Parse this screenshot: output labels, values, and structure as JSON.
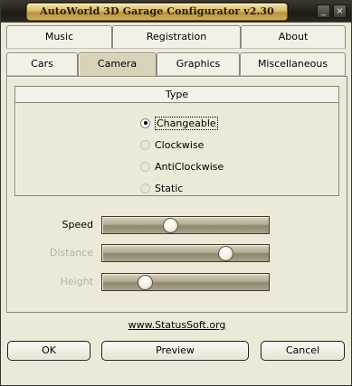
{
  "window": {
    "title": "AutoWorld 3D Garage Configurator v2.30",
    "minimize_glyph": "_",
    "close_glyph": "×"
  },
  "tabs_row1": [
    {
      "label": "Music"
    },
    {
      "label": "Registration"
    },
    {
      "label": "About"
    }
  ],
  "tabs_row2": [
    {
      "label": "Cars",
      "active": false
    },
    {
      "label": "Camera",
      "active": true
    },
    {
      "label": "Graphics",
      "active": false
    },
    {
      "label": "Miscellaneous",
      "active": false
    }
  ],
  "type_group": {
    "title": "Type",
    "options": [
      {
        "label": "Changeable",
        "checked": true
      },
      {
        "label": "Clockwise",
        "checked": false
      },
      {
        "label": "AntiClockwise",
        "checked": false
      },
      {
        "label": "Static",
        "checked": false
      }
    ]
  },
  "sliders": [
    {
      "label": "Speed",
      "enabled": true,
      "value": 0.4
    },
    {
      "label": "Distance",
      "enabled": false,
      "value": 0.76
    },
    {
      "label": "Height",
      "enabled": false,
      "value": 0.23
    }
  ],
  "link": {
    "text": "www.StatusSoft.org"
  },
  "buttons": {
    "ok": "OK",
    "preview": "Preview",
    "cancel": "Cancel"
  }
}
